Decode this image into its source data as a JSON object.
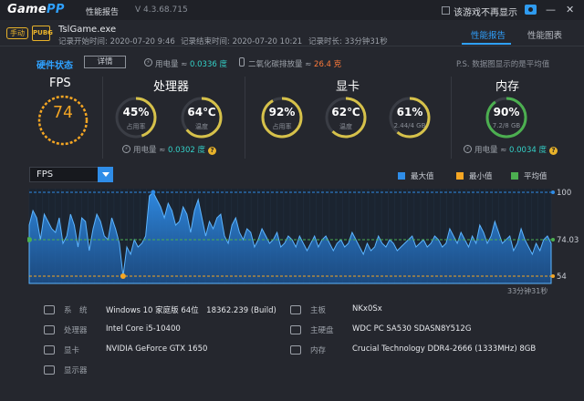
{
  "app": {
    "logo_main": "Game",
    "logo_accent": "PP",
    "window_title": "性能报告",
    "version": "V 4.3.68.715",
    "hide_checkbox_label": "该游戏不再显示",
    "minimize": "—",
    "close": "✕"
  },
  "session": {
    "mode_badge": "手动",
    "game_badge": "PUBG",
    "exe": "TslGame.exe",
    "start_time": "记录开始时间: 2020-07-20 9:46",
    "end_time": "记录结束时间: 2020-07-20 10:21",
    "elapsed": "记录时长: 33分钟31秒"
  },
  "tabs": [
    {
      "label": "性能报告",
      "active": true
    },
    {
      "label": "性能图表",
      "active": false
    }
  ],
  "hardware": {
    "label": "硬件状态",
    "detail_button": "详情",
    "power_prefix": "用电量 ≈ ",
    "power_value": "0.0336 度",
    "co2_prefix": "二氧化碳排放量 ≈ ",
    "co2_value": "26.4 克",
    "ps_note": "P.S. 数据图显示的是平均值"
  },
  "fps": {
    "title": "FPS",
    "value": "74"
  },
  "cpu": {
    "title": "处理器",
    "usage": {
      "value": "45%",
      "sub": "占用率",
      "fraction": 0.45
    },
    "temp": {
      "value": "64℃",
      "sub": "温度",
      "fraction": 0.64
    },
    "power_prefix": "用电量 ≈ ",
    "power_value": "0.0302 度"
  },
  "gpu": {
    "title": "显卡",
    "usage": {
      "value": "92%",
      "sub": "占用率",
      "fraction": 0.92
    },
    "temp": {
      "value": "62℃",
      "sub": "温度",
      "fraction": 0.62
    },
    "vram": {
      "value": "61%",
      "sub": "2.44/4 GB",
      "fraction": 0.61
    }
  },
  "memory": {
    "title": "内存",
    "usage": {
      "value": "90%",
      "sub": "7.2/8 GB",
      "fraction": 0.9
    },
    "power_prefix": "用电量 ≈ ",
    "power_value": "0.0034 度"
  },
  "chart_controls": {
    "metric_selected": "FPS",
    "legend": [
      {
        "label": "最大值",
        "color": "#2f8de8"
      },
      {
        "label": "最小值",
        "color": "#f5a623"
      },
      {
        "label": "平均值",
        "color": "#4caf50"
      }
    ],
    "duration_label": "33分钟31秒"
  },
  "chart_data": {
    "type": "area",
    "title": "",
    "ylim": [
      50,
      102
    ],
    "max_label": "100",
    "avg_label": "74.03",
    "min_label": "54",
    "max": 100,
    "avg": 74.03,
    "min": 54,
    "color": "#2f8de8",
    "values": [
      82,
      90,
      86,
      74,
      88,
      84,
      80,
      78,
      86,
      72,
      76,
      88,
      82,
      70,
      86,
      84,
      68,
      80,
      88,
      84,
      76,
      74,
      86,
      80,
      72,
      54,
      70,
      66,
      74,
      70,
      72,
      76,
      98,
      100,
      96,
      92,
      86,
      94,
      90,
      82,
      84,
      92,
      88,
      78,
      90,
      96,
      86,
      76,
      84,
      80,
      86,
      88,
      76,
      72,
      82,
      86,
      78,
      74,
      80,
      78,
      70,
      74,
      80,
      76,
      72,
      74,
      78,
      70,
      72,
      76,
      74,
      70,
      76,
      72,
      68,
      72,
      76,
      70,
      74,
      76,
      72,
      68,
      72,
      74,
      70,
      72,
      78,
      74,
      70,
      66,
      72,
      68,
      70,
      76,
      72,
      70,
      74,
      72,
      68,
      70,
      72,
      74,
      76,
      70,
      72,
      74,
      70,
      72,
      76,
      74,
      70,
      72,
      80,
      76,
      72,
      78,
      74,
      70,
      76,
      72,
      82,
      78,
      72,
      76,
      84,
      78,
      72,
      74,
      76,
      68,
      72,
      80,
      74,
      70,
      66,
      72,
      68,
      74,
      76,
      72
    ]
  },
  "specs": {
    "left": [
      {
        "icon": "monitor-system-icon",
        "label": "系　统",
        "value": "Windows 10 家庭版 64位　18362.239 (Build)"
      },
      {
        "icon": "cpu-icon",
        "label": "处理器",
        "value": "Intel Core i5-10400"
      },
      {
        "icon": "gpu-icon",
        "label": "显卡",
        "value": "NVIDIA GeForce GTX 1650"
      },
      {
        "icon": "display-icon",
        "label": "显示器",
        "value": ""
      }
    ],
    "right": [
      {
        "icon": "motherboard-icon",
        "label": "主板",
        "value": "NKx0Sx"
      },
      {
        "icon": "disk-icon",
        "label": "主硬盘",
        "value": "WDC PC SA530 SDASN8Y512G"
      },
      {
        "icon": "ram-icon",
        "label": "内存",
        "value": "Crucial Technology DDR4-2666 (1333MHz) 8GB"
      }
    ]
  }
}
